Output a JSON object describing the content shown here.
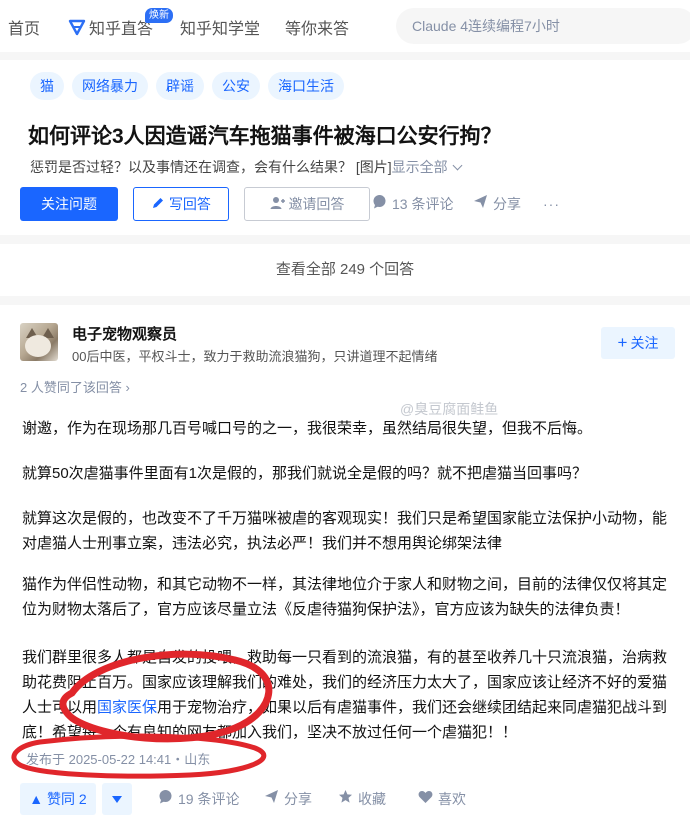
{
  "nav": {
    "home": "首页",
    "zhida": "知乎直答",
    "zhida_badge": "焕新",
    "learn": "知乎知学堂",
    "wait": "等你来答",
    "search_placeholder": "Claude 4连续编程7小时"
  },
  "question": {
    "tags": [
      "猫",
      "网络暴力",
      "辟谣",
      "公安",
      "海口生活"
    ],
    "title": "如何评论3人因造谣汽车拖猫事件被海口公安行拘？",
    "description": "惩罚是否过轻？以及事情还在调查，会有什么结果？ [图片]",
    "show_all": "显示全部",
    "follow_label": "关注问题",
    "write_label": "写回答",
    "invite_label": "邀请回答",
    "comments": "13 条评论",
    "share": "分享",
    "more": "···"
  },
  "view_all": "查看全部 249 个回答",
  "answer": {
    "author": "电子宠物观察员",
    "headline": "00后中医，平权斗士，致力于救助流浪猫狗，只讲道理不起情绪",
    "follow_label": "关注",
    "voters": "2 人赞同了该回答",
    "watermark": "@臭豆腐面鲑鱼",
    "p1": "谢邀，作为在现场那几百号喊口号的之一，我很荣幸，虽然结局很失望，但我不后悔。",
    "p2": "就算50次虐猫事件里面有1次是假的，那我们就说全是假的吗？就不把虐猫当回事吗？",
    "p3": "就算这次是假的，也改变不了千万猫咪被虐的客观现实！我们只是希望国家能立法保护小动物，能对虐猫人士刑事立案，违法必究，执法必严！我们并不想用舆论绑架法律",
    "p4": "猫作为伴侣性动物，和其它动物不一样，其法律地位介于家人和财物之间，目前的法律仅仅将其定位为财物太落后了，官方应该尽量立法《反虐待猫狗保护法》，官方应该为缺失的法律负责！",
    "p5_a": "我们群里很多人都是自发的投喂，救助每一只看到的流浪猫，有的甚至收养几十只流浪猫，治病救助花费阻止百万。国家应该理解我们的难处，我们的经济压力太大了，国家应该让经济不好的爱猫人士可以用",
    "p5_link": "国家医保",
    "p5_b": "用于宠物治疗，如果以后有虐猫事件，我们还会继续团结起来同虐猫犯战斗到底！希望每一个有良知的网友都加入我们，坚决不放过任何一个虐猫犯！！",
    "published": "发布于 2025-05-22 14:41・山东",
    "upvote_label": "▲ 赞同 2",
    "comments": "19 条评论",
    "share": "分享",
    "favorite": "收藏",
    "like": "喜欢",
    "bottom_watermark": "@臭豆腐面鲑鱼"
  },
  "colors": {
    "brand": "#1a66ff",
    "annotation": "#e0262b"
  }
}
